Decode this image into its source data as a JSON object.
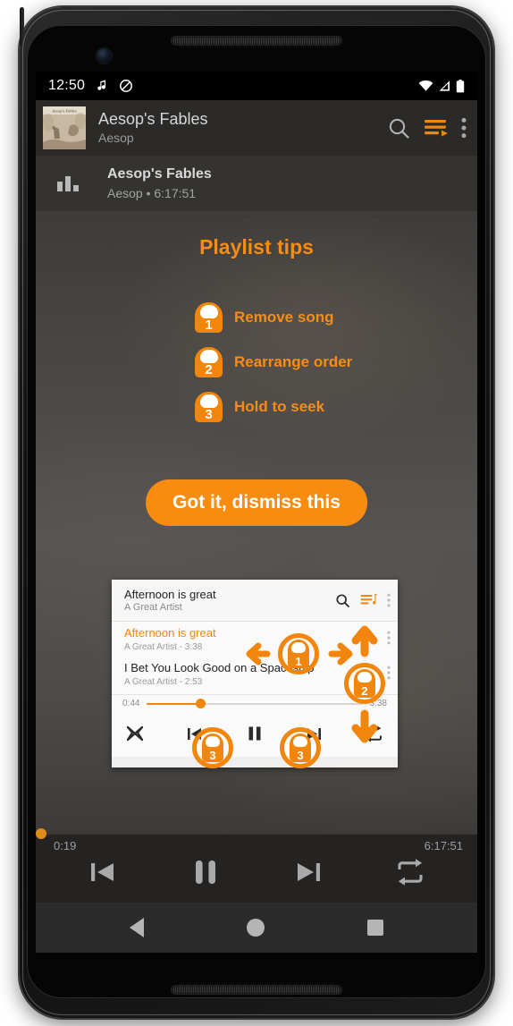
{
  "status_bar": {
    "time": "12:50",
    "left_icons": [
      "music-note-notification-icon",
      "do-not-disturb-icon"
    ],
    "right_icons": [
      "wifi-icon",
      "cellular-signal-icon",
      "battery-icon"
    ]
  },
  "app_bar": {
    "title": "Aesop's Fables",
    "subtitle": "Aesop",
    "album_art_caption": "Aesop's Fables",
    "icons": [
      "search-icon",
      "playlist-queue-icon",
      "overflow-menu-icon"
    ]
  },
  "now_playing": {
    "title": "Aesop's Fables",
    "artist": "Aesop",
    "separator": "•",
    "duration": "6:17:51",
    "meta": "Aesop  •  6:17:51"
  },
  "tips": {
    "heading": "Playlist tips",
    "items": [
      {
        "number": "1",
        "label": "Remove song"
      },
      {
        "number": "2",
        "label": "Rearrange order"
      },
      {
        "number": "3",
        "label": "Hold to seek"
      }
    ],
    "dismiss_label": "Got it, dismiss this"
  },
  "demo_card": {
    "header": {
      "title": "Afternoon is great",
      "subtitle": "A Great Artist",
      "icons": [
        "search-icon",
        "playlist-queue-icon",
        "overflow-menu-icon"
      ]
    },
    "tracks": [
      {
        "title": "Afternoon is great",
        "meta": "A Great Artist  -  3:38",
        "active": "true"
      },
      {
        "title": "I Bet You Look Good on a Spaceship",
        "meta": "A Great Artist  -  2:53",
        "active": "false"
      }
    ],
    "seek": {
      "elapsed": "0:44",
      "total": "3:38",
      "progress_percent": 25
    },
    "controls": [
      "shuffle-icon",
      "previous-track-icon",
      "pause-icon",
      "next-track-icon",
      "repeat-icon"
    ],
    "markers": [
      {
        "number": "1",
        "gesture": "swipe-horizontal"
      },
      {
        "number": "2",
        "gesture": "drag-vertical"
      },
      {
        "number": "3",
        "gesture": "hold-previous"
      },
      {
        "number": "3",
        "gesture": "hold-next"
      }
    ]
  },
  "player": {
    "elapsed": "0:19",
    "total": "6:17:51",
    "progress_percent": 0,
    "controls": [
      "previous-track-icon",
      "pause-icon",
      "next-track-icon",
      "repeat-icon"
    ]
  },
  "nav_bar": {
    "buttons": [
      "back-button",
      "home-button",
      "recents-button"
    ]
  },
  "colors": {
    "accent_orange": "#F2860C",
    "button_orange": "#F78C10",
    "app_bar_bg": "#2B2A28",
    "player_bg": "#242322",
    "nav_bg": "#2B2B2B"
  }
}
